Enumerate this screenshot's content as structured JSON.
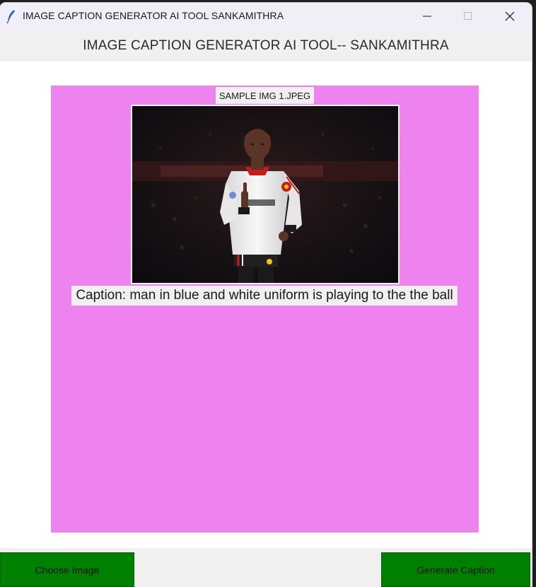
{
  "window": {
    "title": "IMAGE CAPTION GENERATOR AI TOOL SANKAMITHRA",
    "app_icon": "feather-icon",
    "controls": [
      "minimize-icon",
      "maximize-icon",
      "close-icon"
    ]
  },
  "header": {
    "title": "IMAGE CAPTION GENERATOR AI TOOL-- SANKAMITHRA"
  },
  "main": {
    "image_filename": "SAMPLE IMG 1.JPEG",
    "caption": "Caption: man in blue and white uniform is playing to the the ball",
    "panel_color": "#ee82ee"
  },
  "buttons": {
    "choose_label": "Choose Image",
    "generate_label": "Generate Caption",
    "color": "#008000"
  }
}
